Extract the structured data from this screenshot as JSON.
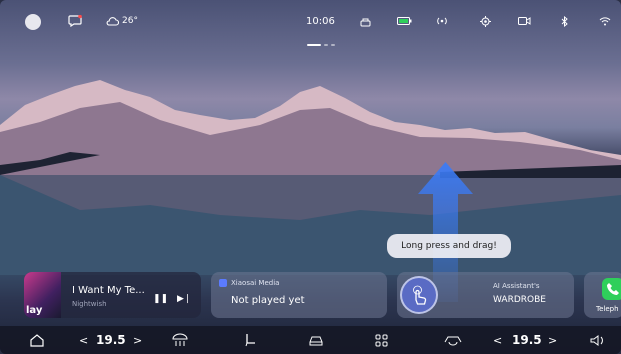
{
  "status": {
    "weather": "26°",
    "time": "10:06"
  },
  "music": {
    "title": "I Want My Te...",
    "artist": "Nightwish",
    "cover_text": "lay",
    "pause": "❚❚",
    "next": "▶❘"
  },
  "media": {
    "source": "Xiaosai Media",
    "status": "Not played yet"
  },
  "tooltip": "Long press and drag!",
  "ai": {
    "label": "AI Assistant's",
    "mode": "WARDROBE"
  },
  "phone": {
    "label": "Teleph"
  },
  "dock": {
    "left_temp": "19.5",
    "right_temp": "19.5",
    "prev": "<",
    "next": ">"
  },
  "colors": {
    "accent": "#5b7bff",
    "battery": "#2fcf5b"
  }
}
